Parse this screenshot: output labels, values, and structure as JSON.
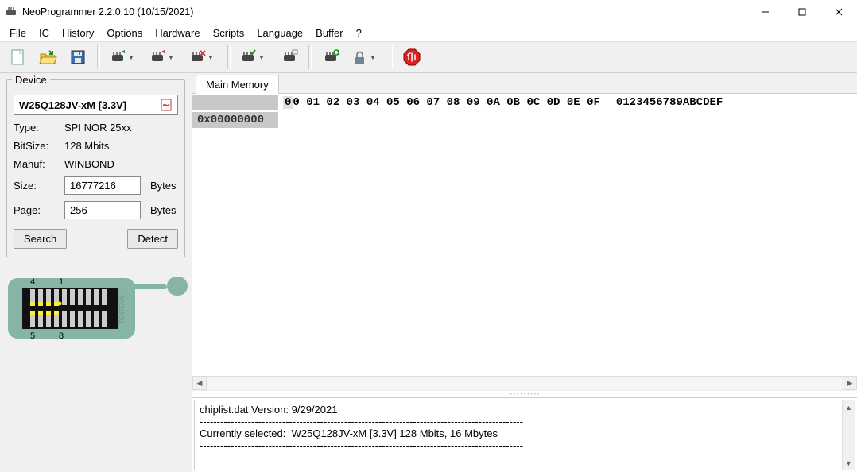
{
  "titlebar": {
    "title": "NeoProgrammer 2.2.0.10 (10/15/2021)"
  },
  "menu": [
    "File",
    "IC",
    "History",
    "Options",
    "Hardware",
    "Scripts",
    "Language",
    "Buffer",
    "?"
  ],
  "toolbar": {
    "new": "new-file-icon",
    "open": "open-folder-icon",
    "save": "save-diskette-icon",
    "chip_read": "chip-read-icon",
    "chip_write": "chip-write-icon",
    "chip_erase": "chip-erase-icon",
    "chip_verify": "chip-verify-icon",
    "chip_blankcheck": "chip-blankcheck-icon",
    "chip_autoprog": "chip-auto-icon",
    "lock": "lock-icon",
    "stop": "stop-icon"
  },
  "device_panel": {
    "legend": "Device",
    "device_name": "W25Q128JV-xM [3.3V]",
    "type_label": "Type:",
    "type_value": "SPI NOR 25xx",
    "bitsize_label": "BitSize:",
    "bitsize_value": "128 Mbits",
    "manuf_label": "Manuf:",
    "manuf_value": "WINBOND",
    "size_label": "Size:",
    "size_value": "16777216",
    "size_unit": "Bytes",
    "page_label": "Page:",
    "page_value": "256",
    "page_unit": "Bytes",
    "search_btn": "Search",
    "detect_btn": "Detect"
  },
  "socket": {
    "pin_tl": "4",
    "pin_tr": "1",
    "pin_bl": "5",
    "pin_br": "8",
    "side_text": "TEXTOOL"
  },
  "hex": {
    "tab_label": "Main Memory",
    "header_hex": "00 01 02 03 04 05 06 07 08 09 0A 0B 0C 0D 0E 0F",
    "header_ascii": "0123456789ABCDEF",
    "rows": [
      {
        "addr": "0x00000000",
        "data": "",
        "ascii": ""
      }
    ]
  },
  "log": {
    "lines": "chiplist.dat Version: 9/29/2021\n----------------------------------------------------------------------------------------------\nCurrently selected:  W25Q128JV-xM [3.3V] 128 Mbits, 16 Mbytes\n----------------------------------------------------------------------------------------------"
  }
}
